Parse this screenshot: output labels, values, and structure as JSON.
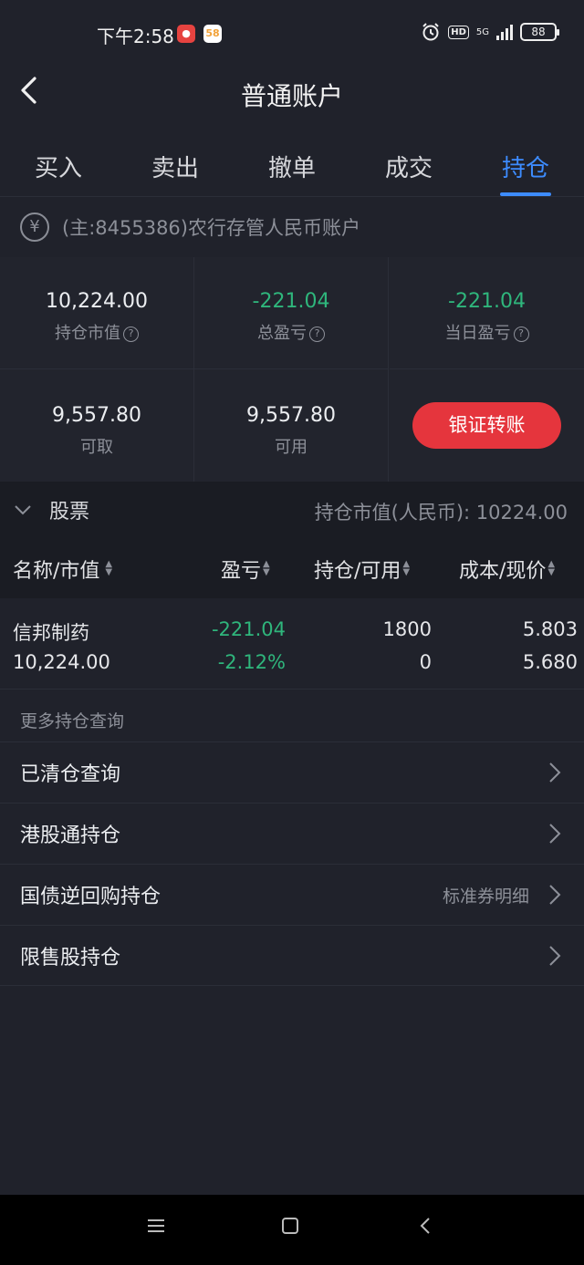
{
  "status_bar": {
    "time": "下午2:58",
    "app_badge_58": "58",
    "network": "5G",
    "hd": "HD",
    "battery": "88"
  },
  "nav": {
    "title": "普通账户"
  },
  "tabs": [
    {
      "label": "买入"
    },
    {
      "label": "卖出"
    },
    {
      "label": "撤单"
    },
    {
      "label": "成交"
    },
    {
      "label": "持仓"
    }
  ],
  "account": {
    "currency_symbol": "¥",
    "text": "(主:8455386)农行存管人民币账户"
  },
  "summary": {
    "market_value": {
      "value": "10,224.00",
      "label": "持仓市值"
    },
    "total_pl": {
      "value": "-221.04",
      "label": "总盈亏"
    },
    "today_pl": {
      "value": "-221.04",
      "label": "当日盈亏"
    },
    "withdrawable": {
      "value": "9,557.80",
      "label": "可取"
    },
    "available": {
      "value": "9,557.80",
      "label": "可用"
    },
    "transfer_button": "银证转账"
  },
  "section": {
    "title": "股票",
    "market_value_text": "持仓市值(人民币): 10224.00"
  },
  "columns": {
    "name": "名称/市值",
    "pl": "盈亏",
    "holding": "持仓/可用",
    "cost": "成本/现价"
  },
  "positions": [
    {
      "name": "信邦制药",
      "market_value": "10,224.00",
      "pl": "-221.04",
      "pl_pct": "-2.12%",
      "holding": "1800",
      "available": "0",
      "cost": "5.803",
      "price": "5.680"
    }
  ],
  "more": {
    "label": "更多持仓查询",
    "links": [
      {
        "label": "已清仓查询",
        "hint": ""
      },
      {
        "label": "港股通持仓",
        "hint": ""
      },
      {
        "label": "国债逆回购持仓",
        "hint": "标准券明细"
      },
      {
        "label": "限售股持仓",
        "hint": ""
      }
    ]
  },
  "colors": {
    "accent": "#3d8cff",
    "loss_green": "#2fb67c",
    "button_red": "#e5353d",
    "background": "#20222b"
  }
}
